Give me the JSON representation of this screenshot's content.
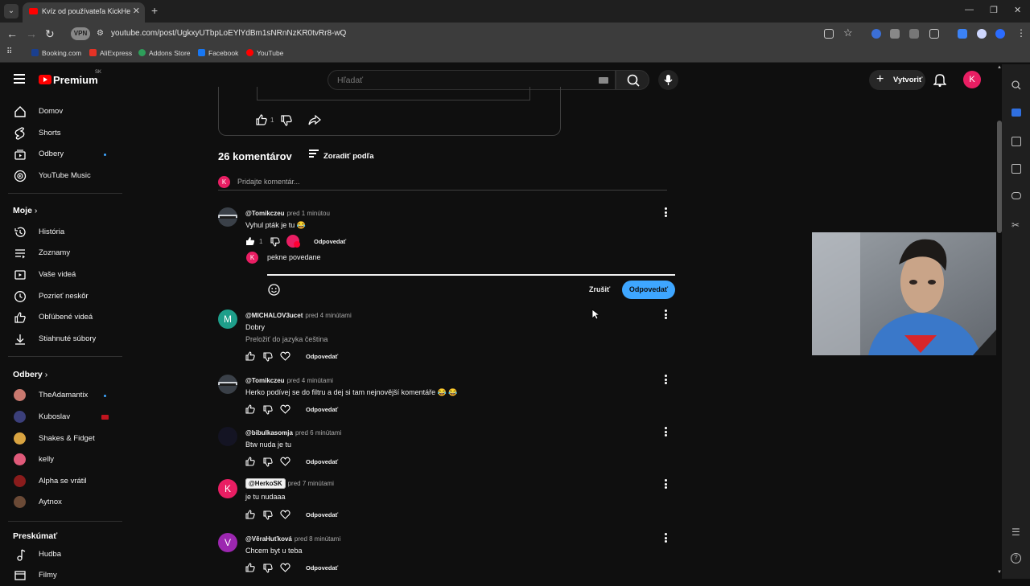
{
  "browser": {
    "tab_title": "Kvíz od používateľa KickHerko",
    "url": "youtube.com/post/UgkxyUTbpLoEYlYdBm1sNRnNzKR0tvRr8-wQ",
    "vpn_label": "VPN",
    "bookmarks": [
      "Booking.com",
      "AliExpress",
      "Addons Store",
      "Facebook",
      "YouTube"
    ]
  },
  "header": {
    "logo_text": "Premium",
    "logo_region": "SK",
    "search_placeholder": "Hľadať",
    "create_label": "Vytvoriť",
    "avatar_letter": "K"
  },
  "sidebar": {
    "main": [
      {
        "label": "Domov",
        "icon": "home-icon"
      },
      {
        "label": "Shorts",
        "icon": "shorts-icon"
      },
      {
        "label": "Odbery",
        "icon": "subscriptions-icon"
      },
      {
        "label": "YouTube Music",
        "icon": "music-icon"
      }
    ],
    "you_heading": "Moje",
    "you": [
      {
        "label": "História",
        "icon": "history-icon"
      },
      {
        "label": "Zoznamy",
        "icon": "playlists-icon"
      },
      {
        "label": "Vaše videá",
        "icon": "your-videos-icon"
      },
      {
        "label": "Pozrieť neskôr",
        "icon": "watch-later-icon"
      },
      {
        "label": "Obľúbené videá",
        "icon": "liked-icon"
      },
      {
        "label": "Stiahnuté súbory",
        "icon": "downloads-icon"
      }
    ],
    "subs_heading": "Odbery",
    "subs": [
      {
        "label": "TheAdamantix",
        "color": "#c9796f"
      },
      {
        "label": "Kuboslav",
        "color": "#3b3f7a"
      },
      {
        "label": "Shakes & Fidget",
        "color": "#d9a441"
      },
      {
        "label": "kelly",
        "color": "#e05a7a"
      },
      {
        "label": "Alpha se vrátil",
        "color": "#8a1c1c"
      },
      {
        "label": "Aytnox",
        "color": "#6b4a36"
      }
    ],
    "explore_heading": "Preskúmať",
    "explore": [
      {
        "label": "Hudba",
        "icon": "music-note-icon"
      },
      {
        "label": "Filmy",
        "icon": "film-icon"
      }
    ]
  },
  "post": {
    "likes": "1"
  },
  "comments_section": {
    "count_label": "26 komentárov",
    "sort_label": "Zoradiť podľa",
    "add_placeholder": "Pridajte komentár...",
    "reply_label": "Odpovedať",
    "cancel_label": "Zrušiť",
    "reply_input_value": "pekne povedane",
    "comments": [
      {
        "author": "@Tomikczeu",
        "time": "pred 1 minútou",
        "text": "Vyhul pták je tu 😂",
        "likes": "1"
      },
      {
        "author": "@MICHALOV3ucet",
        "time": "pred 4 minútami",
        "text": "Dobry",
        "translate": "Preložiť do jazyka čeština",
        "avatar_letter": "M"
      },
      {
        "author": "@Tomikczeu",
        "time": "pred 4 minútami",
        "text": "Herko podívej se do filtru a dej si tam nejnovější komentáře 😂 😂"
      },
      {
        "author": "@bibulkasomja",
        "time": "pred 6 minútami",
        "text": "Btw nuda je tu"
      },
      {
        "author": "@HerkoSK",
        "time": "pred 7 minútami",
        "text": "je tu nudaaa",
        "avatar_letter": "K"
      },
      {
        "author": "@VěraHuťková",
        "time": "pred 8 minútami",
        "text": "Chcem byt u teba",
        "avatar_letter": "V"
      }
    ]
  },
  "colors": {
    "accent": "#3ea6ff",
    "brand": "#ff0000",
    "avatar_pink": "#e91e63",
    "avatar_teal": "#1e9e8a",
    "avatar_purple": "#9c27b0"
  }
}
